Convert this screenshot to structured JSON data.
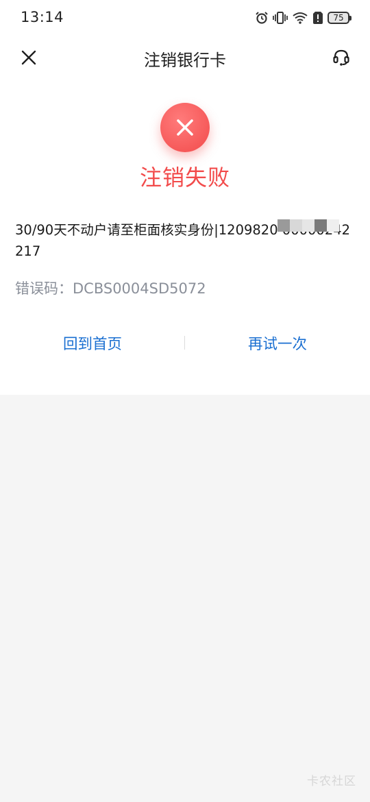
{
  "status_bar": {
    "time": "13:14",
    "battery": "75",
    "icons": [
      "alarm-icon",
      "vibrate-icon",
      "wifi-icon",
      "alert-icon",
      "battery-icon"
    ]
  },
  "header": {
    "title": "注销银行卡",
    "close_icon": "close-icon",
    "service_icon": "headset-icon"
  },
  "result": {
    "status_icon": "fail-x-icon",
    "title": "注销失败",
    "message": "30/90天不动户请至柜面核实身份|1209820      00000242217",
    "error_code": "错误码：DCBS0004SD5072"
  },
  "actions": {
    "home_label": "回到首页",
    "retry_label": "再试一次"
  },
  "watermark": "卡农社区",
  "colors": {
    "accent": "#1a6fd1",
    "error": "#f24b4b",
    "muted": "#8a8f99",
    "background": "#f5f5f5"
  }
}
